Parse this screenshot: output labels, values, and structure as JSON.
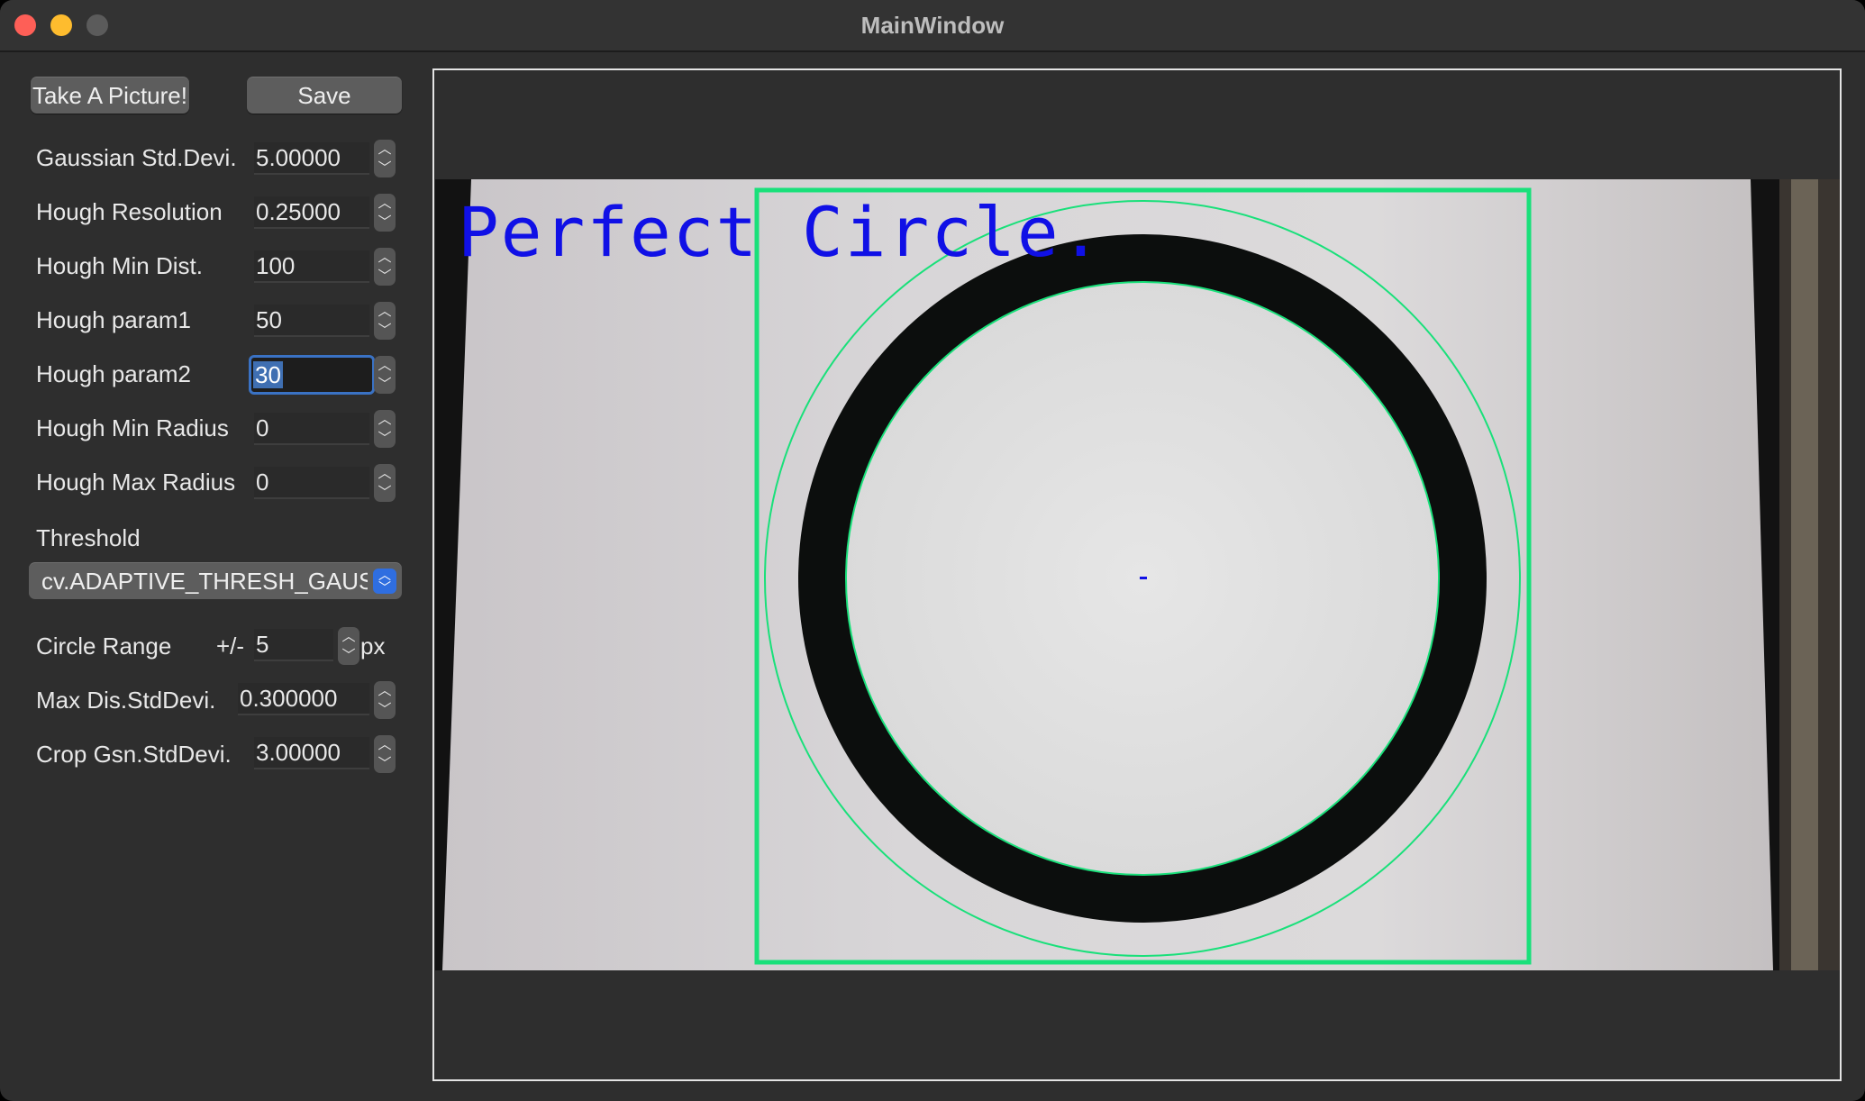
{
  "window": {
    "title": "MainWindow"
  },
  "toolbar": {
    "take_label": "Take A Picture!",
    "save_label": "Save"
  },
  "params": {
    "gaussian": {
      "label": "Gaussian Std.Devi.",
      "value": "5.00000"
    },
    "hough_res": {
      "label": "Hough Resolution",
      "value": "0.25000"
    },
    "hough_min_dist": {
      "label": "Hough Min Dist.",
      "value": "100"
    },
    "hough_p1": {
      "label": "Hough param1",
      "value": "50"
    },
    "hough_p2": {
      "label": "Hough param2",
      "value": "30"
    },
    "hough_min_r": {
      "label": "Hough Min Radius",
      "value": "0"
    },
    "hough_max_r": {
      "label": "Hough Max Radius",
      "value": "0"
    },
    "threshold": {
      "label": "Threshold",
      "selected": "cv.ADAPTIVE_THRESH_GAUSSIAN_C"
    },
    "circle_range": {
      "label": "Circle Range",
      "prefix": "+/-",
      "value": "5",
      "unit": "px"
    },
    "max_dis": {
      "label": "Max Dis.StdDevi.",
      "value": "0.300000"
    },
    "crop_gsn": {
      "label": "Crop Gsn.StdDevi.",
      "value": "3.00000"
    }
  },
  "viewer": {
    "overlay_text": "Perfect Circle.",
    "overlay_color": "#1010e6",
    "box_color": "#19e07a"
  }
}
